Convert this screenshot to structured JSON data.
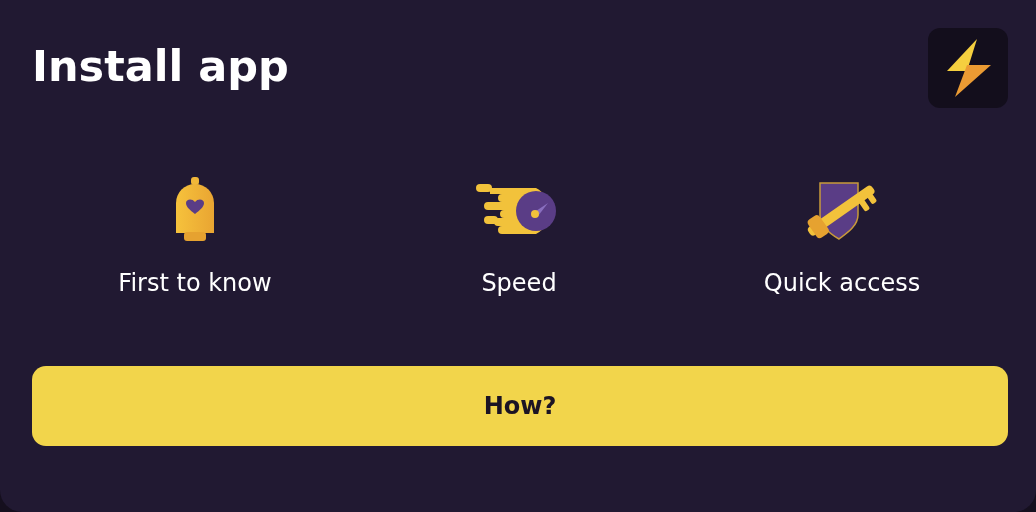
{
  "title": "Install app",
  "features": [
    {
      "kind": "bell",
      "label": "First to know"
    },
    {
      "kind": "speed",
      "label": "Speed"
    },
    {
      "kind": "key",
      "label": "Quick access"
    }
  ],
  "button": {
    "label": "How?"
  }
}
